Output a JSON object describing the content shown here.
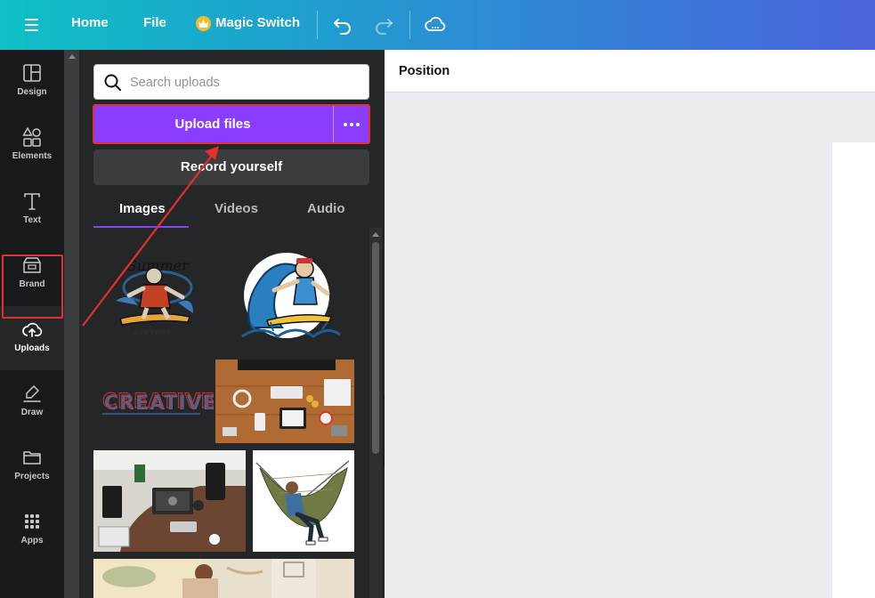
{
  "topbar": {
    "home_label": "Home",
    "file_label": "File",
    "magic_switch_label": "Magic Switch"
  },
  "rail": {
    "items": [
      {
        "label": "Design",
        "icon": "layout-icon"
      },
      {
        "label": "Elements",
        "icon": "shapes-icon"
      },
      {
        "label": "Text",
        "icon": "text-icon"
      },
      {
        "label": "Brand",
        "icon": "brand-icon"
      },
      {
        "label": "Uploads",
        "icon": "cloud-upload-icon",
        "active": true
      },
      {
        "label": "Draw",
        "icon": "draw-icon"
      },
      {
        "label": "Projects",
        "icon": "folder-icon"
      },
      {
        "label": "Apps",
        "icon": "apps-grid-icon"
      }
    ]
  },
  "panel": {
    "search_placeholder": "Search uploads",
    "upload_label": "Upload files",
    "record_label": "Record yourself",
    "tabs": [
      {
        "label": "Images",
        "active": true
      },
      {
        "label": "Videos"
      },
      {
        "label": "Audio"
      }
    ],
    "thumbnails": [
      {
        "name": "surfer-skeleton-illustration"
      },
      {
        "name": "surfer-wave-illustration"
      },
      {
        "name": "creative-text-graphic",
        "text": "CREATIVE"
      },
      {
        "name": "desk-flatlay-photo"
      },
      {
        "name": "workspace-desk-photo"
      },
      {
        "name": "hammock-man-photo"
      },
      {
        "name": "outdoor-woman-photo"
      }
    ]
  },
  "canvas": {
    "position_label": "Position"
  },
  "colors": {
    "accent": "#8b3dff",
    "highlight": "#e2302a",
    "topbar_start": "#0fc0c5",
    "topbar_end": "#4a63d9"
  }
}
